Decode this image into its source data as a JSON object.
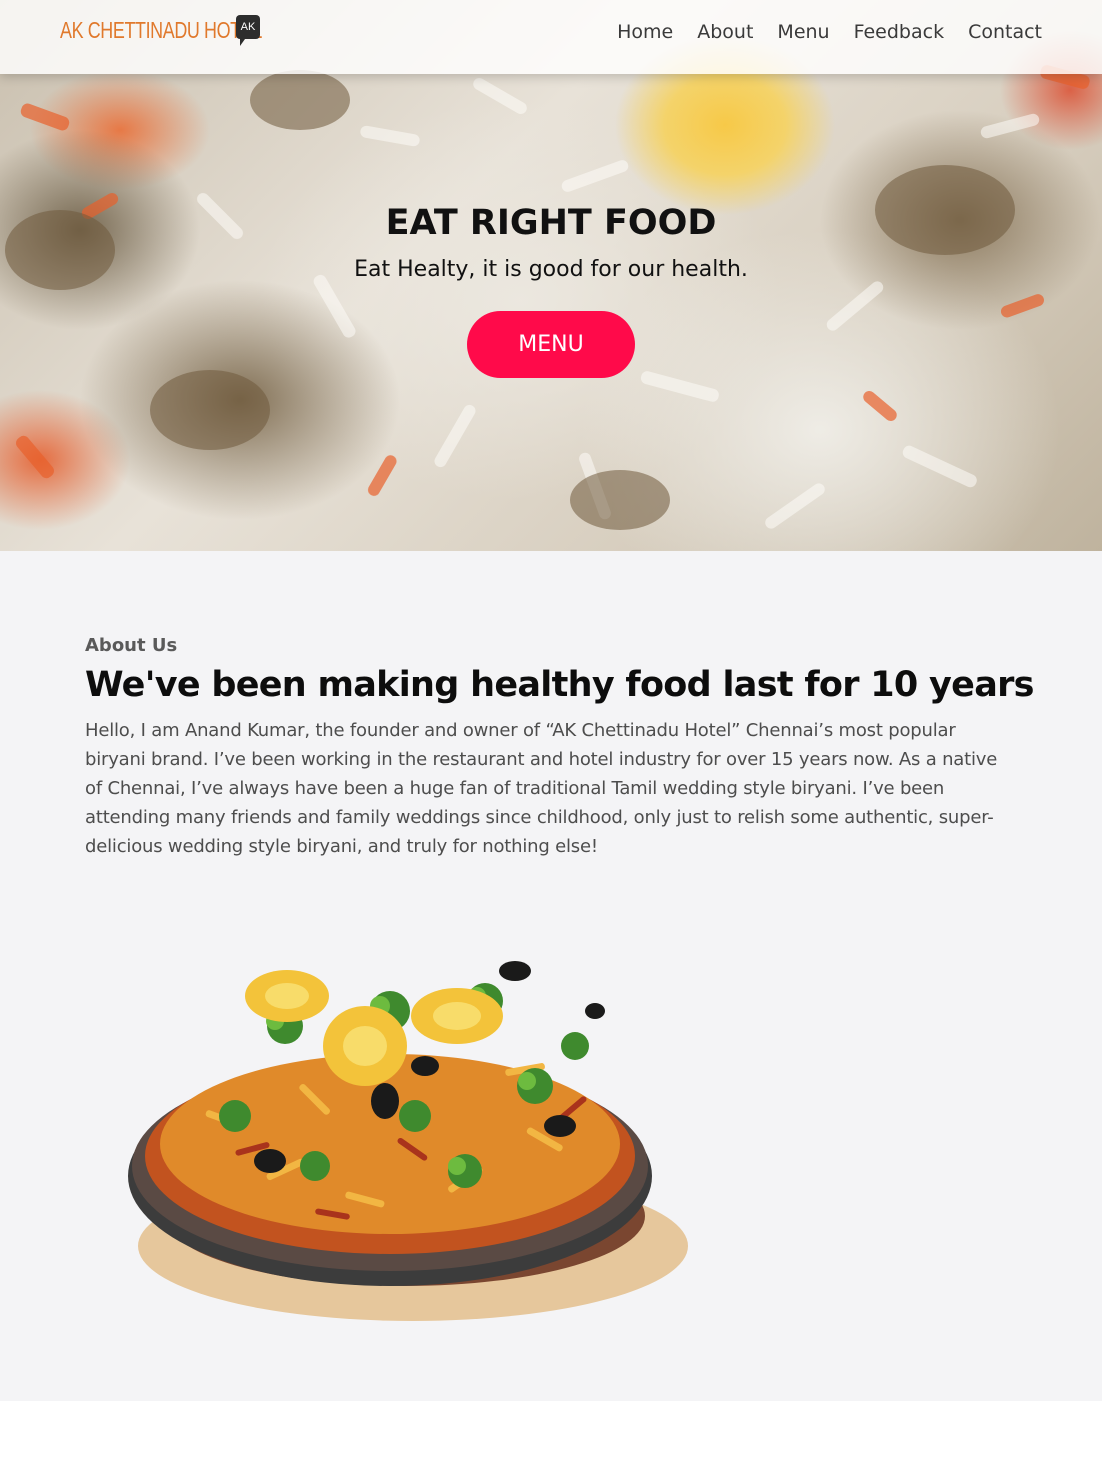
{
  "nav": {
    "logo_text": "AK CHETTINADU HOTEL",
    "logo_badge": "AK",
    "links": [
      "Home",
      "About",
      "Menu",
      "Feedback",
      "Contact"
    ]
  },
  "hero": {
    "title": "EAT RIGHT FOOD",
    "subtitle": "Eat Healty, it is good for our health.",
    "button_label": "MENU"
  },
  "about": {
    "eyebrow": "About Us",
    "heading": "We've been making healthy food last for 10 years",
    "body": "Hello, I am Anand Kumar, the founder and owner of “AK Chettinadu Hotel” Chennai’s most popular biryani brand. I’ve been working in the restaurant and hotel industry for over 15 years now. As a native of Chennai, I’ve always have been a huge fan of traditional Tamil wedding style biryani. I’ve been attending many friends and family weddings since childhood, only just to relish some authentic, super-delicious wedding style biryani, and truly for nothing else!"
  },
  "colors": {
    "accent": "#ff0a4a",
    "logo": "#e0792c",
    "section_bg": "#f4f4f6"
  }
}
